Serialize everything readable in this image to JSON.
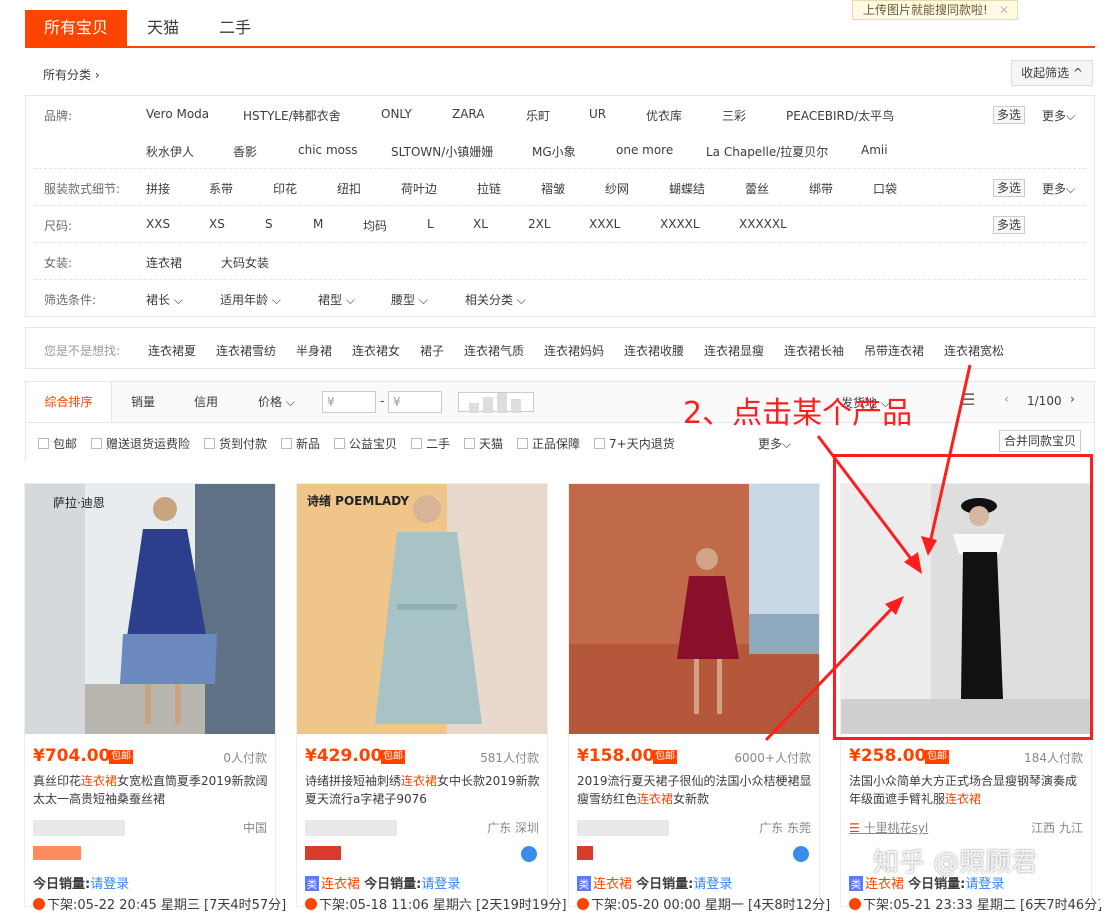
{
  "tabs": [
    "所有宝贝",
    "天猫",
    "二手"
  ],
  "upload_tip": "上传图片就能搜同款啦!",
  "all_categories": "所有分类 ›",
  "collapse_filter": "收起筛选 ^",
  "filters": {
    "brand_label": "品牌:",
    "brands_row1": [
      "Vero Moda",
      "HSTYLE/韩都衣舍",
      "ONLY",
      "ZARA",
      "乐町",
      "UR",
      "优衣库",
      "三彩",
      "PEACEBIRD/太平鸟"
    ],
    "brands_row2": [
      "秋水伊人",
      "香影",
      "chic moss",
      "SLTOWN/小镇姗姗",
      "MG小象",
      "one more",
      "La Chapelle/拉夏贝尔",
      "Amii"
    ],
    "detail_label": "服装款式细节:",
    "details": [
      "拼接",
      "系带",
      "印花",
      "纽扣",
      "荷叶边",
      "拉链",
      "褶皱",
      "纱网",
      "蝴蝶结",
      "蕾丝",
      "绑带",
      "口袋"
    ],
    "size_label": "尺码:",
    "sizes": [
      "XXS",
      "XS",
      "S",
      "M",
      "均码",
      "L",
      "XL",
      "2XL",
      "XXXL",
      "XXXXL",
      "XXXXXL"
    ],
    "women_label": "女装:",
    "women": [
      "连衣裙",
      "大码女装"
    ],
    "cond_label": "筛选条件:",
    "conds": [
      "裙长 ⌵",
      "适用年龄 ⌵",
      "裙型 ⌵",
      "腰型 ⌵",
      "相关分类 ⌵"
    ],
    "multi_select": "多选",
    "more": "更多⌵"
  },
  "suggest": {
    "label": "您是不是想找:",
    "items": [
      "连衣裙夏",
      "连衣裙雪纺",
      "半身裙",
      "连衣裙女",
      "裙子",
      "连衣裙气质",
      "连衣裙妈妈",
      "连衣裙收腰",
      "连衣裙显瘦",
      "连衣裙长袖",
      "吊带连衣裙",
      "连衣裙宽松"
    ]
  },
  "sort": {
    "items": [
      "综合排序",
      "销量",
      "信用",
      "价格 ⌵"
    ],
    "price_from": "¥",
    "price_to": "¥",
    "dash": "-",
    "ship_to": "发货地 ⌵",
    "page": "1/100",
    "checks": [
      "包邮",
      "赠送退货运费险",
      "货到付款",
      "新品",
      "公益宝贝",
      "二手",
      "天猫",
      "正品保障",
      "7+天内退货"
    ],
    "checks_more": "更多⌵",
    "merge": "合并同款宝贝"
  },
  "annotation": "2、点击某个产品",
  "products": [
    {
      "price": "¥704.00",
      "baoyou": "包邮",
      "sales": "0人付款",
      "title_pre": "真丝印花",
      "title_hl": "连衣裙",
      "title_post": "女宽松直筒夏季2019新款阔太太一高贵短袖桑蚕丝裙",
      "shop": "",
      "loc": "中国",
      "tags": "",
      "today_label": "今日销量:",
      "today_link": "请登录",
      "off": "下架:05-22 20:45 星期三 [7天4时57分]",
      "brand_text": "萨拉·迪恩"
    },
    {
      "price": "¥429.00",
      "baoyou": "包邮",
      "sales": "581人付款",
      "title_pre": "诗绪拼接短袖刺绣",
      "title_hl": "连衣裙",
      "title_post": "女中长款2019新款夏天流行a字裙子9076",
      "shop": "",
      "loc": "广东 深圳",
      "tags": "连衣裙",
      "today_label": "今日销量:",
      "today_link": "请登录",
      "off": "下架:05-18 11:06 星期六 [2天19时19分]",
      "brand_text": "诗绪 POEMLADY"
    },
    {
      "price": "¥158.00",
      "baoyou": "包邮",
      "sales": "6000+人付款",
      "title_pre": "2019流行夏天裙子很仙的法国小众桔梗裙显瘦雪纺红色",
      "title_hl": "连衣裙",
      "title_post": "女新款",
      "shop": "",
      "loc": "广东 东莞",
      "tags": "连衣裙",
      "today_label": "今日销量:",
      "today_link": "请登录",
      "off": "下架:05-20 00:00 星期一 [4天8时12分]",
      "brand_text": ""
    },
    {
      "price": "¥258.00",
      "baoyou": "包邮",
      "sales": "184人付款",
      "title_pre": "法国小众简单大方正式场合显瘦钢琴演奏成年级面遮手臂礼服",
      "title_hl": "连衣裙",
      "title_post": "",
      "shop": "十里桃花syl",
      "loc": "江西 九江",
      "tags": "连衣裙",
      "today_label": "今日销量:",
      "today_link": "请登录",
      "off": "下架:05-21 23:33 星期二 [6天7时46分]",
      "brand_text": ""
    }
  ],
  "watermark": "知乎 @照顾君",
  "colors": {
    "accent": "#ff4400",
    "annotation": "#ff1e1e"
  }
}
